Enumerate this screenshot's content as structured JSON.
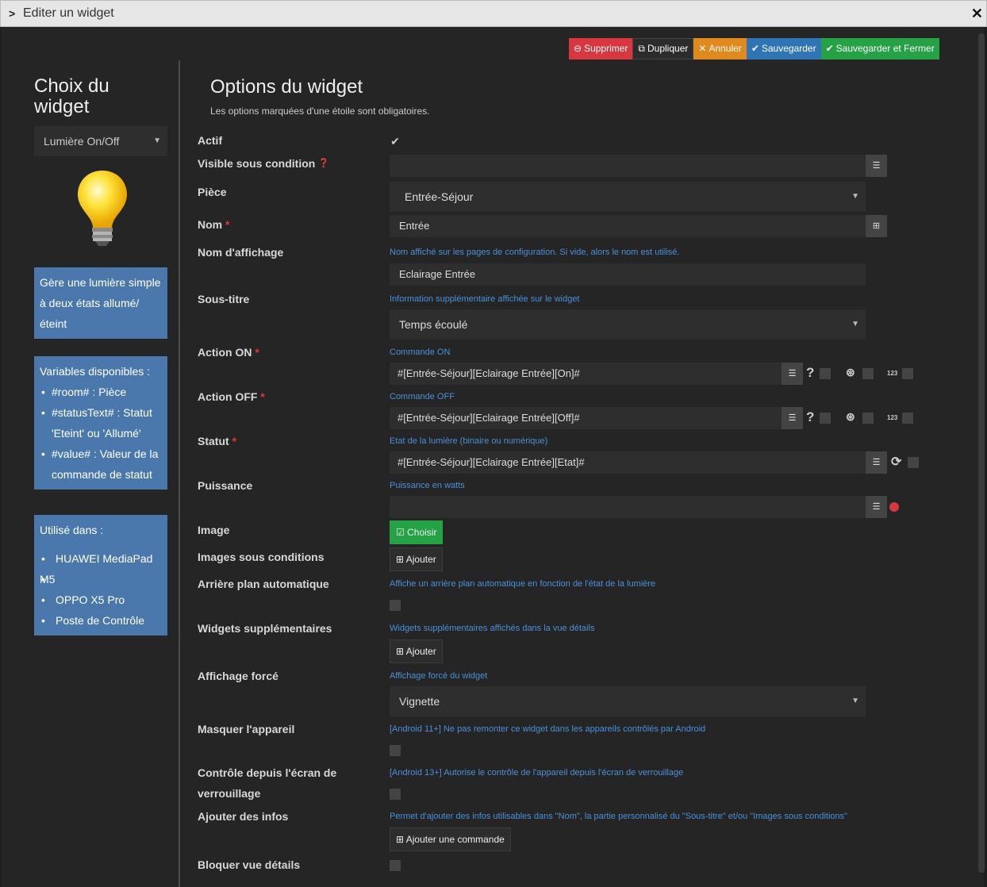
{
  "window": {
    "title": "Editer un widget"
  },
  "toolbar": {
    "delete": "Supprimer",
    "duplicate": "Dupliquer",
    "cancel": "Annuler",
    "save": "Sauvegarder",
    "save_close": "Sauvegarder et Fermer"
  },
  "left": {
    "title_line1": "Choix du",
    "title_line2": "widget",
    "type_select": "Lumière On/Off",
    "description_lines": [
      "Gère une lumière simple",
      "à deux états allumé/",
      "éteint"
    ],
    "variables_title": "Variables disponibles :",
    "variables": [
      {
        "l1": "#room# : Pièce",
        "l2": ""
      },
      {
        "l1": "#statusText# : Statut",
        "l2": "'Eteint' ou 'Allumé'"
      },
      {
        "l1": "#value# : Valeur de la",
        "l2": "commande de statut"
      }
    ],
    "used_title": "Utilisé dans :",
    "used_in": [
      {
        "l1": "HUAWEI MediaPad",
        "l2": "M5"
      },
      {
        "l1": "OPPO X5 Pro",
        "l2": ""
      },
      {
        "l1": "Poste de Contrôle",
        "l2": ""
      }
    ]
  },
  "main": {
    "title": "Options du widget",
    "subtitle": "Les options marquées d'une étoile sont obligatoires.",
    "labels": {
      "actif": "Actif",
      "visible": "Visible sous condition",
      "piece": "Pièce",
      "nom": "Nom",
      "nom_affichage": "Nom d'affichage",
      "sous_titre": "Sous-titre",
      "action_on": "Action ON",
      "action_off": "Action OFF",
      "statut": "Statut",
      "puissance": "Puissance",
      "image": "Image",
      "images_cond": "Images sous conditions",
      "arriere_plan": "Arrière plan automatique",
      "widgets_supp": "Widgets supplémentaires",
      "affichage_force": "Affichage forcé",
      "masquer": "Masquer l'appareil",
      "controle_l1": "Contrôle depuis l'écran de",
      "controle_l2": "verrouillage",
      "ajouter_infos": "Ajouter des infos",
      "bloquer": "Bloquer vue détails"
    },
    "help": {
      "nom_affichage": "Nom affiché sur les pages de configuration. Si vide, alors le nom est utilisé.",
      "sous_titre": "Information supplémentaire affichée sur le widget",
      "action_on": "Commande ON",
      "action_off": "Commande OFF",
      "statut": "Etat de la lumière (binaire ou numérique)",
      "puissance": "Puissance en watts",
      "arriere_plan": "Affiche un arrière plan automatique en fonction de l'état de la lumière",
      "widgets_supp": "Widgets supplémentaires affichés dans la vue détails",
      "affichage_force": "Affichage forcé du widget",
      "masquer": "[Android 11+] Ne pas remonter ce widget dans les appareils contrôlés par Android",
      "controle": "[Android 13+] Autorise le contrôle de l'appareil depuis l'écran de verrouillage",
      "ajouter_infos": "Permet d'ajouter des infos utilisables dans \"Nom\", la partie personnalisé du \"Sous-titre\" et/ou \"Images sous conditions\""
    },
    "values": {
      "visible": "",
      "piece": "Entrée-Séjour",
      "nom": "Entrée",
      "nom_affichage": "Eclairage Entrée",
      "sous_titre": "Temps écoulé",
      "action_on": "#[Entrée-Séjour][Eclairage Entrée][On]#",
      "action_off": "#[Entrée-Séjour][Eclairage Entrée][Off]#",
      "statut": "#[Entrée-Séjour][Eclairage Entrée][Etat]#",
      "puissance": "",
      "affichage_force": "Vignette"
    },
    "buttons": {
      "choisir": "Choisir",
      "ajouter": "Ajouter",
      "ajouter_commande": "Ajouter une commande"
    },
    "badge_123": "123"
  },
  "colors": {
    "delete": "#d9373f",
    "cancel": "#e08a1e",
    "save": "#2f74b5",
    "save_close": "#25a246",
    "info_box": "#4a78ad",
    "help_text": "#4a90d9"
  }
}
